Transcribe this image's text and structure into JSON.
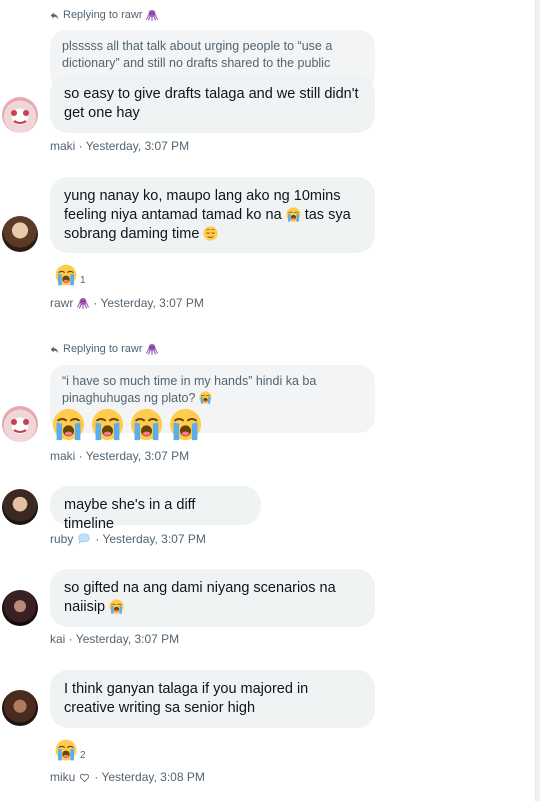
{
  "messages": [
    {
      "reply_label": "Replying to rawr",
      "quoted": "plsssss all that talk about urging people to “use a dictionary” and still no drafts shared to the public",
      "text": "so easy to give drafts talaga and we still didn't get one hay",
      "meta": "maki · Yesterday, 3:07 PM"
    },
    {
      "text": "yung nanay ko, maupo lang ako ng 10mins feeling niya antamad tamad ko na",
      "text_tail1": "tas sya sobrang daming time",
      "reaction_count": "1",
      "meta_name": "rawr",
      "meta_time": "· Yesterday, 3:07 PM"
    },
    {
      "reply_label": "Replying to rawr",
      "quoted": "“i have so much time in my hands” hindi ka ba pinaghuhugas ng plato?",
      "meta": "maki · Yesterday, 3:07 PM"
    },
    {
      "text": "maybe she's in a diff timeline",
      "meta_name": "ruby",
      "meta_time": "· Yesterday, 3:07 PM"
    },
    {
      "text": "so gifted na ang dami niyang scenarios na naiisip",
      "meta": "kai · Yesterday, 3:07 PM"
    },
    {
      "text": "I think ganyan talaga if you majored in creative writing sa senior high",
      "reaction_count": "2",
      "meta_name": "miku",
      "meta_time": "· Yesterday, 3:08 PM"
    }
  ],
  "icons": {
    "reply": "reply-arrow-icon",
    "octopus": "octopus-emoji",
    "crying": "loudly-crying-face-emoji",
    "relieved": "relieved-face-emoji",
    "speech": "speech-balloon-emoji",
    "heart": "white-heart-emoji"
  },
  "colors": {
    "bubble": "#eff3f4",
    "quoted": "#f2f4f5",
    "meta": "#536471",
    "text": "#0f1419"
  }
}
